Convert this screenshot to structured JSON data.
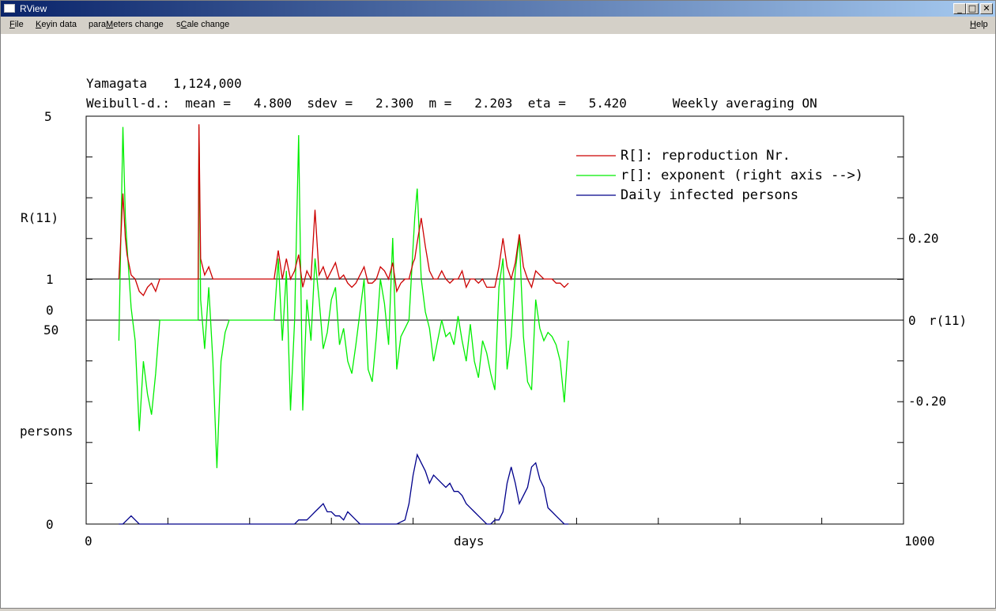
{
  "window": {
    "title": "RView"
  },
  "menu": {
    "file": "File",
    "keyin": "Keyin data",
    "params": "paraMeters change",
    "scale": "sCale change",
    "help": "Help"
  },
  "header": {
    "region": "Yamagata",
    "population": "1,124,000",
    "params_line": "Weibull-d.:  mean =   4.800  sdev =   2.300  m =   2.203  eta =   5.420      Weekly averaging ON"
  },
  "axes": {
    "R_label": "R(11)",
    "R_max": "5",
    "R_one": "1",
    "R_zero": "0",
    "persons_label": "persons",
    "persons_max": "50",
    "persons_zero": "0",
    "x_label": "days",
    "x_min": "0",
    "x_max": "1000",
    "r_label": "r(11)",
    "r_top": "0.20",
    "r_zero": "0",
    "r_bottom": "-0.20"
  },
  "colors": {
    "reproduction": "#cc0000",
    "exponent": "#00ee00",
    "daily": "#00008b"
  },
  "chart_data": {
    "type": "line",
    "xlabel": "days",
    "xlim": [
      0,
      1000
    ],
    "legend_position": "top-right",
    "series": [
      {
        "name": "R[]: reproduction Nr.",
        "axis": "left R",
        "ylim": [
          0,
          5
        ],
        "x": [
          40,
          45,
          48,
          50,
          55,
          60,
          65,
          70,
          75,
          80,
          85,
          90,
          110,
          137,
          138,
          140,
          145,
          150,
          155,
          160,
          165,
          170,
          175,
          230,
          235,
          240,
          245,
          250,
          255,
          260,
          265,
          270,
          275,
          280,
          285,
          290,
          295,
          300,
          305,
          310,
          315,
          320,
          325,
          330,
          335,
          340,
          345,
          350,
          355,
          360,
          365,
          370,
          375,
          380,
          385,
          390,
          395,
          400,
          402,
          405,
          410,
          415,
          420,
          425,
          430,
          435,
          440,
          445,
          450,
          455,
          460,
          465,
          470,
          475,
          480,
          485,
          490,
          495,
          500,
          505,
          510,
          515,
          520,
          525,
          530,
          535,
          540,
          545,
          550,
          555,
          560,
          565,
          570,
          575,
          580,
          585,
          590
        ],
        "y": [
          1.0,
          3.1,
          2.0,
          1.6,
          1.1,
          1.0,
          0.7,
          0.6,
          0.8,
          0.9,
          0.7,
          1.0,
          1.0,
          1.0,
          4.8,
          1.5,
          1.1,
          1.3,
          1.0,
          1.0,
          1.0,
          1.0,
          1.0,
          1.0,
          1.7,
          1.0,
          1.5,
          1.0,
          1.2,
          1.6,
          0.8,
          1.2,
          1.0,
          2.7,
          1.1,
          1.3,
          1.0,
          1.2,
          1.4,
          1.0,
          1.1,
          0.9,
          0.8,
          0.9,
          1.1,
          1.3,
          0.9,
          0.9,
          1.0,
          1.3,
          1.2,
          1.0,
          1.4,
          0.7,
          0.9,
          1.0,
          1.0,
          1.4,
          1.5,
          1.9,
          2.5,
          1.8,
          1.2,
          1.0,
          1.0,
          1.2,
          1.0,
          0.9,
          1.0,
          1.0,
          1.2,
          0.8,
          1.0,
          1.0,
          0.9,
          1.0,
          0.8,
          0.8,
          0.8,
          1.3,
          2.0,
          1.3,
          1.0,
          1.4,
          2.1,
          1.3,
          1.0,
          0.8,
          1.2,
          1.1,
          1.0,
          1.0,
          1.0,
          0.9,
          0.9,
          0.8,
          0.9
        ]
      },
      {
        "name": "r[]: exponent (right axis -->)",
        "axis": "right r",
        "ylim": [
          -0.4,
          0.6
        ],
        "x": [
          40,
          45,
          48,
          50,
          55,
          60,
          65,
          70,
          75,
          80,
          85,
          90,
          110,
          137,
          138,
          140,
          145,
          150,
          155,
          160,
          165,
          170,
          175,
          230,
          235,
          240,
          245,
          250,
          255,
          260,
          265,
          270,
          275,
          280,
          285,
          290,
          295,
          300,
          305,
          310,
          315,
          320,
          325,
          330,
          335,
          340,
          345,
          350,
          355,
          360,
          365,
          370,
          375,
          380,
          385,
          390,
          395,
          400,
          402,
          405,
          410,
          415,
          420,
          425,
          430,
          435,
          440,
          445,
          450,
          455,
          460,
          465,
          470,
          475,
          480,
          485,
          490,
          495,
          500,
          505,
          510,
          515,
          520,
          525,
          530,
          535,
          540,
          545,
          550,
          555,
          560,
          565,
          570,
          575,
          580,
          585,
          590
        ],
        "y": [
          -0.05,
          0.47,
          0.25,
          0.18,
          0.03,
          -0.05,
          -0.27,
          -0.1,
          -0.18,
          -0.23,
          -0.13,
          0.0,
          0.0,
          0.0,
          0.47,
          0.05,
          -0.07,
          0.08,
          -0.1,
          -0.36,
          -0.1,
          -0.03,
          0.0,
          0.0,
          0.15,
          -0.05,
          0.12,
          -0.22,
          0.0,
          0.45,
          -0.22,
          0.05,
          -0.05,
          0.15,
          0.05,
          -0.07,
          -0.03,
          0.05,
          0.08,
          -0.06,
          -0.02,
          -0.1,
          -0.13,
          -0.06,
          0.02,
          0.1,
          -0.12,
          -0.15,
          -0.04,
          0.1,
          0.04,
          -0.06,
          0.2,
          -0.12,
          -0.04,
          -0.02,
          0.0,
          0.18,
          0.25,
          0.32,
          0.1,
          0.02,
          -0.02,
          -0.1,
          -0.05,
          0.0,
          -0.04,
          -0.03,
          -0.06,
          0.01,
          -0.05,
          -0.1,
          -0.01,
          -0.1,
          -0.14,
          -0.05,
          -0.08,
          -0.13,
          -0.17,
          0.08,
          0.15,
          -0.12,
          -0.04,
          0.12,
          0.2,
          -0.04,
          -0.15,
          -0.17,
          0.05,
          -0.02,
          -0.05,
          -0.03,
          -0.04,
          -0.06,
          -0.1,
          -0.2,
          -0.05
        ]
      },
      {
        "name": "Daily infected persons",
        "axis": "left persons",
        "ylim": [
          0,
          50
        ],
        "x": [
          40,
          45,
          50,
          55,
          60,
          65,
          70,
          75,
          80,
          85,
          90,
          100,
          140,
          150,
          160,
          170,
          180,
          190,
          200,
          210,
          220,
          230,
          240,
          250,
          255,
          260,
          265,
          270,
          275,
          280,
          285,
          290,
          295,
          300,
          305,
          310,
          315,
          320,
          325,
          330,
          335,
          340,
          345,
          350,
          355,
          360,
          370,
          380,
          390,
          395,
          400,
          405,
          410,
          415,
          420,
          425,
          430,
          435,
          440,
          445,
          450,
          455,
          460,
          465,
          470,
          475,
          480,
          485,
          490,
          495,
          500,
          505,
          510,
          515,
          520,
          525,
          530,
          535,
          540,
          545,
          550,
          555,
          560,
          565,
          570,
          575,
          580,
          585,
          590
        ],
        "y": [
          0,
          0,
          1,
          2,
          1,
          0,
          0,
          0,
          0,
          0,
          0,
          0,
          0,
          0,
          0,
          0,
          0,
          0,
          0,
          0,
          0,
          0,
          0,
          0,
          0,
          1,
          1,
          1,
          2,
          3,
          4,
          5,
          3,
          3,
          2,
          2,
          1,
          3,
          2,
          1,
          0,
          0,
          0,
          0,
          0,
          0,
          0,
          0,
          1,
          5,
          12,
          17,
          15,
          13,
          10,
          12,
          11,
          10,
          9,
          10,
          8,
          8,
          7,
          5,
          4,
          3,
          2,
          1,
          0,
          0,
          1,
          1,
          3,
          10,
          14,
          10,
          5,
          7,
          9,
          14,
          15,
          11,
          9,
          4,
          3,
          2,
          1,
          0,
          0
        ]
      }
    ]
  }
}
